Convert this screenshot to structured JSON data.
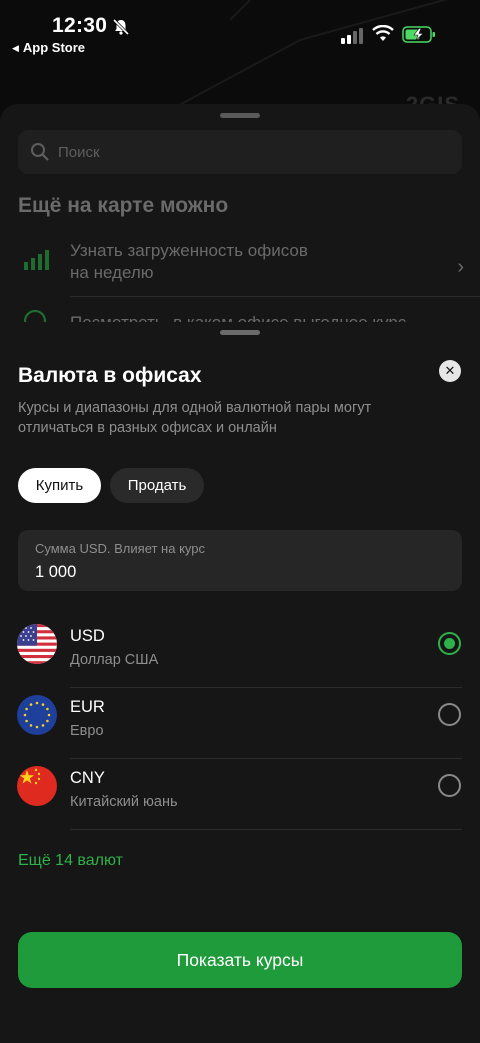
{
  "status_bar": {
    "time": "12:30",
    "back_label": "App Store"
  },
  "map": {
    "brand": "2GIS"
  },
  "under_sheet": {
    "search_placeholder": "Поиск",
    "title": "Ещё на карте можно",
    "items": [
      {
        "label_line1": "Узнать загруженность офисов",
        "label_line2": "на неделю",
        "icon": "bar-chart-icon"
      },
      {
        "label_line1": "Посмотреть, в каком офисе выгодное курс",
        "icon": "currency-exchange-icon"
      }
    ]
  },
  "sheet": {
    "title": "Валюта в офисах",
    "close_glyph": "✕",
    "subtitle": "Курсы и диапазоны для одной валютной пары могут отличаться в разных офисах и онлайн",
    "tabs": {
      "buy": "Купить",
      "sell": "Продать",
      "selected": "buy"
    },
    "amount": {
      "label": "Сумма USD. Влияет на курс",
      "value": "1 000"
    },
    "currencies": [
      {
        "code": "USD",
        "name": "Доллар США",
        "flag": "us-flag-icon",
        "selected": true
      },
      {
        "code": "EUR",
        "name": "Евро",
        "flag": "eu-flag-icon",
        "selected": false
      },
      {
        "code": "CNY",
        "name": "Китайский юань",
        "flag": "cn-flag-icon",
        "selected": false
      }
    ],
    "more_link": "Ещё 14 валют",
    "show_button": "Показать курсы"
  },
  "colors": {
    "accent_green": "#2fb24a",
    "button_green": "#1f9b3b",
    "sheet_bg": "#161616"
  }
}
